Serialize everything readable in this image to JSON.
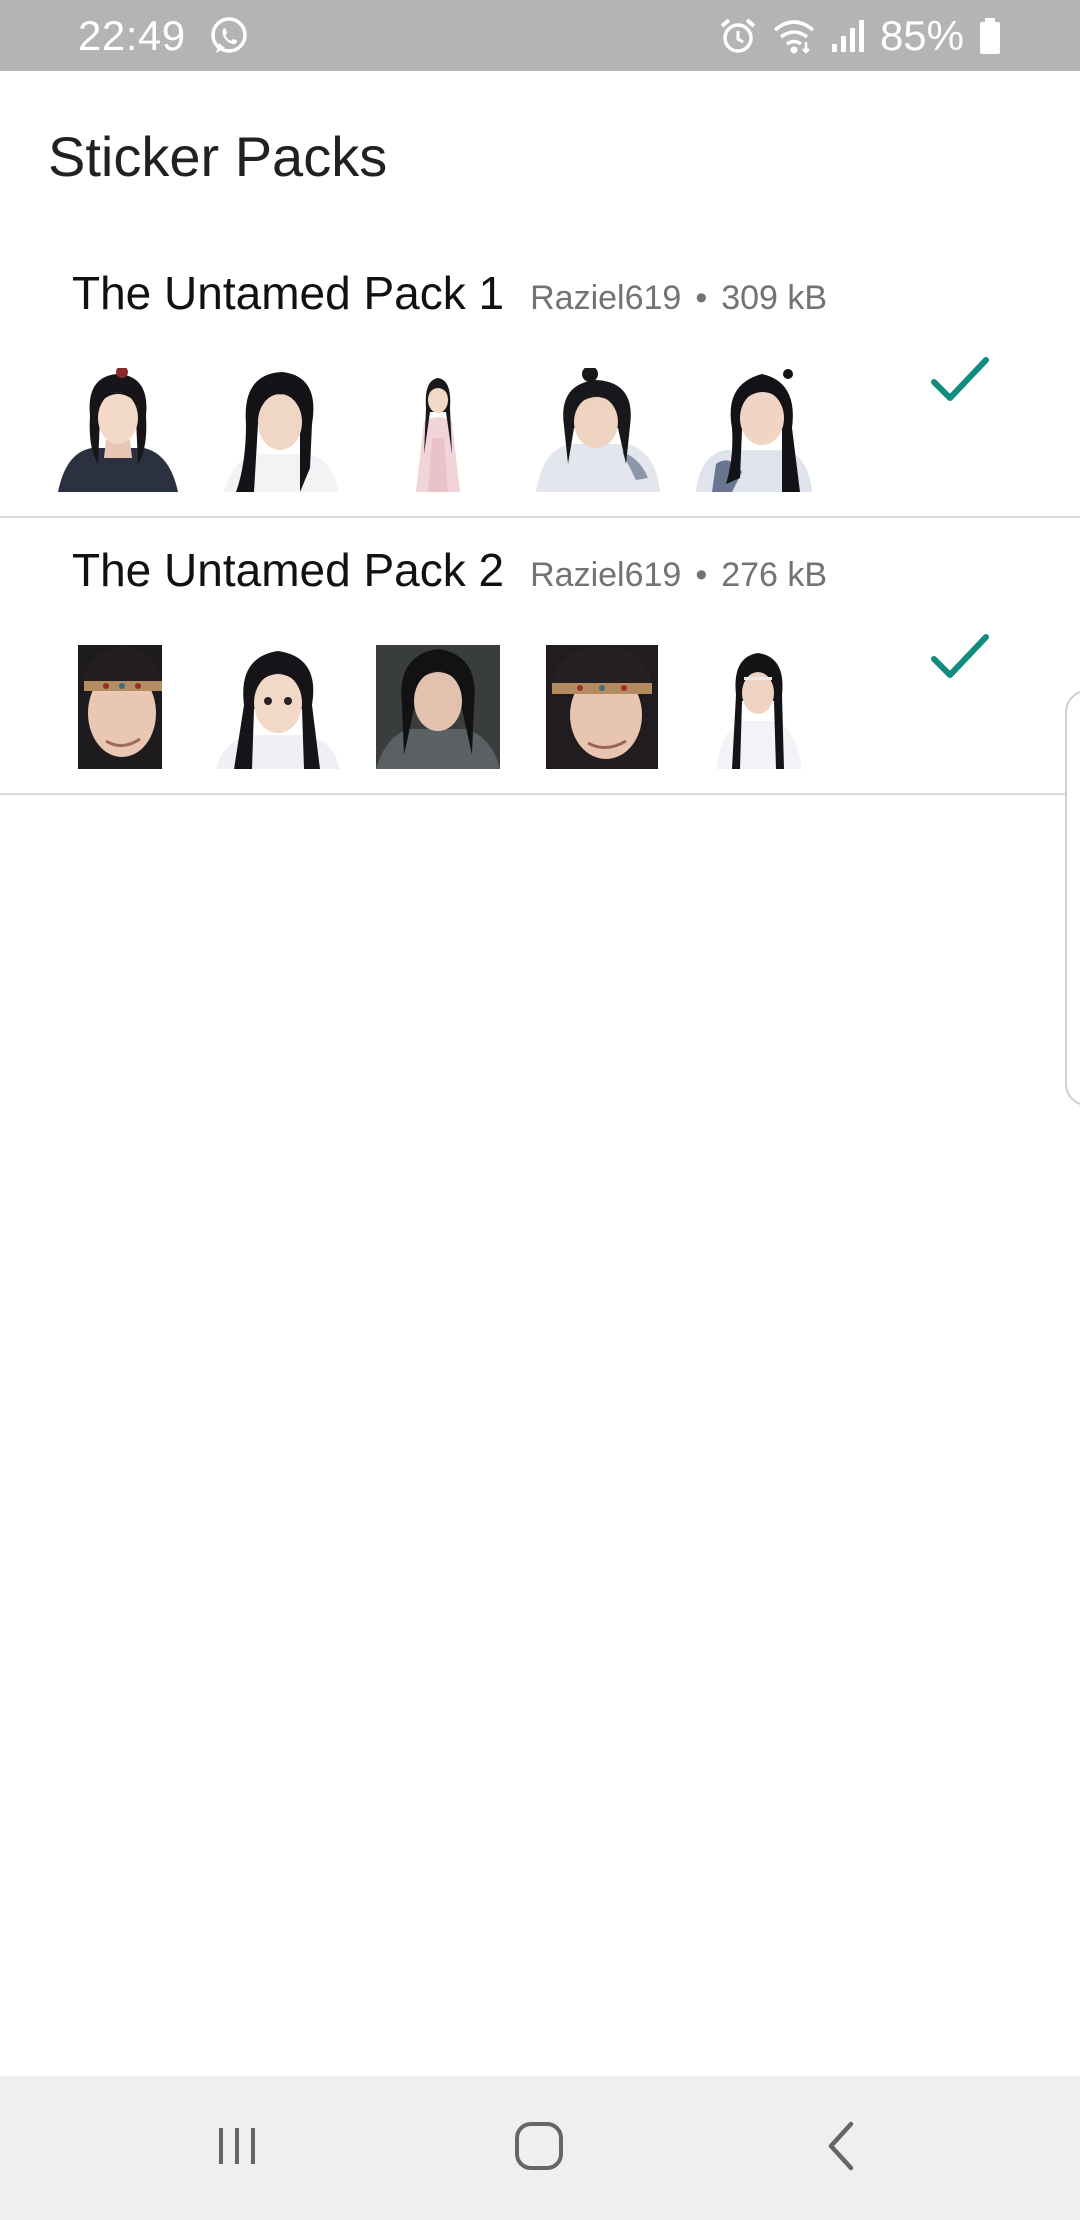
{
  "status_bar": {
    "time": "22:49",
    "battery": "85%",
    "icons": [
      "whatsapp-icon",
      "alarm-icon",
      "wifi-icon",
      "signal-icon",
      "battery-icon"
    ]
  },
  "header": {
    "title": "Sticker Packs"
  },
  "packs": [
    {
      "name": "The Untamed Pack 1",
      "publisher": "Raziel619",
      "separator": "•",
      "size": "309 kB",
      "added": true,
      "thumb_count": 5
    },
    {
      "name": "The Untamed Pack 2",
      "publisher": "Raziel619",
      "separator": "•",
      "size": "276 kB",
      "added": true,
      "thumb_count": 5
    }
  ],
  "nav": {
    "icons": [
      "recents-icon",
      "home-icon",
      "back-icon"
    ]
  },
  "colors": {
    "accent": "#128c7e",
    "status_bar": "#b4b4b4",
    "nav_bar": "#efefef",
    "divider": "#d9d9d9"
  }
}
